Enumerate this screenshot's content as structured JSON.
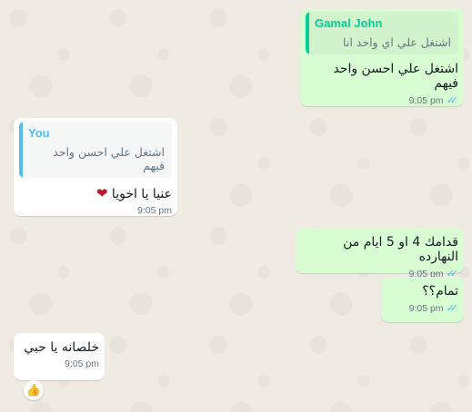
{
  "messages": [
    {
      "quote_name": "Gamal John",
      "quote_text": "اشتغل علي اي واحد انا",
      "text": "اشتغل علي احسن واحد فيهم",
      "time": "9:05 pm"
    },
    {
      "quote_name": "You",
      "quote_text": "اشتغل علي احسن واحد فيهم",
      "text": "عنيا يا اخويا",
      "emoji": "❤",
      "time": "9:05 pm"
    },
    {
      "text": "قدامك 4 او 5 ايام من النهارده",
      "time": "9:05 pm"
    },
    {
      "text": "تمام؟؟",
      "time": "9:05 pm"
    },
    {
      "text": "خلصانه يا حبي",
      "time": "9:05 pm",
      "reaction": "👍"
    }
  ],
  "colors": {
    "background": "#efeae2",
    "outgoing_bubble": "#d9fdd3",
    "incoming_bubble": "#ffffff",
    "quote_green": "#06cf9c",
    "quote_blue": "#53bdeb",
    "read_ticks": "#53bdeb"
  },
  "icons": {
    "read_receipt": "double-check-icon",
    "heart": "heart-emoji",
    "reaction": "thumbs-up-emoji"
  }
}
